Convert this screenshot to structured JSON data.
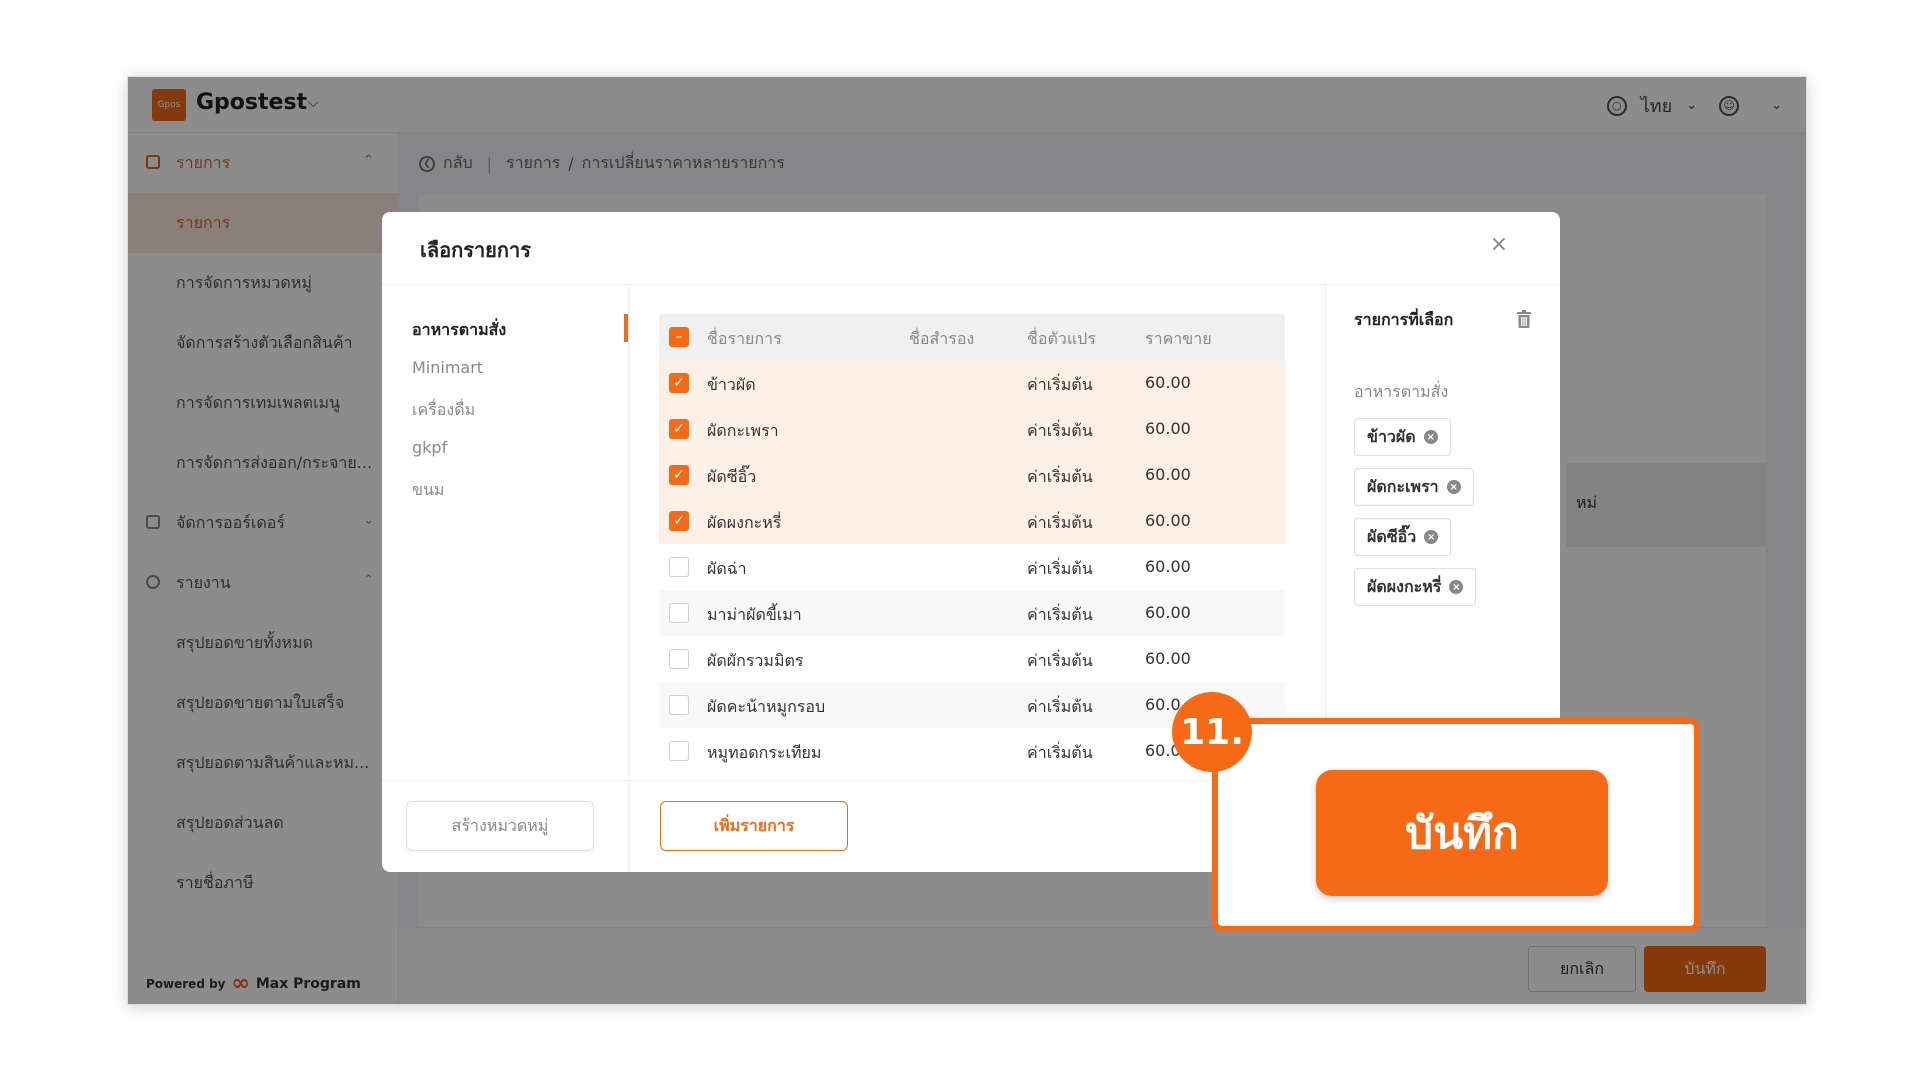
{
  "app": {
    "logo_text": "Gpos",
    "store_name": "Gpostest",
    "language": "ไทย"
  },
  "sidebar": {
    "items": [
      {
        "label": "รายการ",
        "type": "group-open"
      },
      {
        "label": "รายการ",
        "type": "selected"
      },
      {
        "label": "การจัดการหมวดหมู่",
        "type": "sub"
      },
      {
        "label": "จัดการสร้างตัวเลือกสินค้า",
        "type": "sub"
      },
      {
        "label": "การจัดการเทมเพลตเมนู",
        "type": "sub"
      },
      {
        "label": "การจัดการส่งออก/กระจาย...",
        "type": "sub"
      },
      {
        "label": "จัดการออร์เดอร์",
        "type": "group"
      },
      {
        "label": "รายงาน",
        "type": "group"
      },
      {
        "label": "สรุปยอดขายทั้งหมด",
        "type": "sub"
      },
      {
        "label": "สรุปยอดขายตามใบเสร็จ",
        "type": "sub"
      },
      {
        "label": "สรุปยอดตามสินค้าและหม...",
        "type": "sub"
      },
      {
        "label": "สรุปยอดส่วนลด",
        "type": "sub"
      },
      {
        "label": "รายชื่อภาษี",
        "type": "sub"
      }
    ],
    "powered_by": "Powered by",
    "powered_brand": "Max Program"
  },
  "breadcrumb": {
    "back": "กลับ",
    "path1": "รายการ",
    "path2": "การเปลี่ยนราคาหลายรายการ"
  },
  "content": {
    "partial_text": "หม่",
    "cancel_label": "ยกเลิก",
    "save_label": "บันทึก"
  },
  "modal": {
    "title": "เลือกรายการ",
    "categories": [
      "อาหารตามสั่ง",
      "Minimart",
      "เครื่องดื่ม",
      "gkpf",
      "ขนม"
    ],
    "columns": {
      "name": "ชื่อรายการ",
      "alias": "ชื่อสำรอง",
      "variant": "ชื่อตัวแปร",
      "price": "ราคาขาย"
    },
    "rows": [
      {
        "name": "ข้าวผัด",
        "variant": "ค่าเริ่มต้น",
        "price": "60.00",
        "checked": true
      },
      {
        "name": "ผัดกะเพรา",
        "variant": "ค่าเริ่มต้น",
        "price": "60.00",
        "checked": true
      },
      {
        "name": "ผัดซีอิ๊ว",
        "variant": "ค่าเริ่มต้น",
        "price": "60.00",
        "checked": true
      },
      {
        "name": "ผัดผงกะหรี่",
        "variant": "ค่าเริ่มต้น",
        "price": "60.00",
        "checked": true
      },
      {
        "name": "ผัดฉ่า",
        "variant": "ค่าเริ่มต้น",
        "price": "60.00",
        "checked": false
      },
      {
        "name": "มาม่าผัดขี้เมา",
        "variant": "ค่าเริ่มต้น",
        "price": "60.00",
        "checked": false
      },
      {
        "name": "ผัดผักรวมมิตร",
        "variant": "ค่าเริ่มต้น",
        "price": "60.00",
        "checked": false
      },
      {
        "name": "ผัดคะน้าหมูกรอบ",
        "variant": "ค่าเริ่มต้น",
        "price": "60.0",
        "checked": false
      },
      {
        "name": "หมูทอดกระเทียม",
        "variant": "ค่าเริ่มต้น",
        "price": "60.0",
        "checked": false
      }
    ],
    "selected_title": "รายการที่เลือก",
    "selected_category": "อาหารตามสั่ง",
    "selected_tags": [
      "ข้าวผัด",
      "ผัดกะเพรา",
      "ผัดซีอิ๊ว",
      "ผัดผงกะหรี่"
    ],
    "create_category_label": "สร้างหมวดหมู่",
    "add_item_label": "เพิ่มรายการ"
  },
  "callout": {
    "step": "11.",
    "save_label": "บันทึก"
  },
  "colors": {
    "accent": "#f56a17",
    "selected_row": "#fdf0e6"
  }
}
